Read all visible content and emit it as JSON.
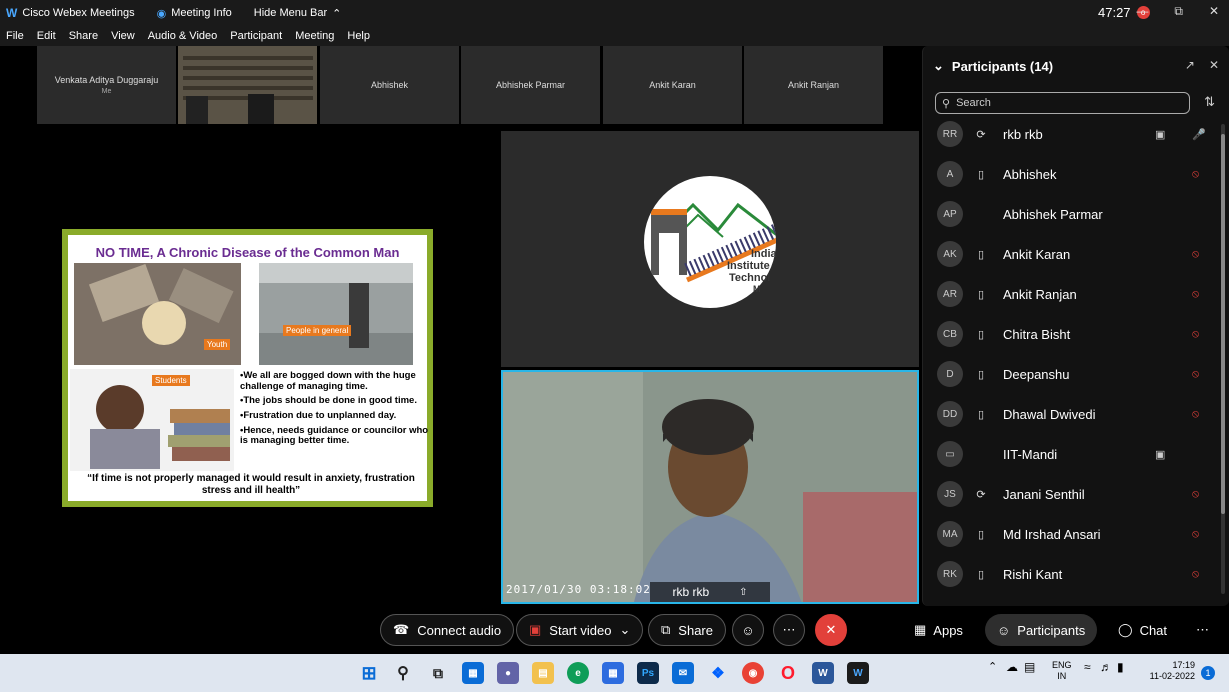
{
  "titlebar": {
    "app_name": "Cisco Webex Meetings",
    "meeting_info": "Meeting Info",
    "hide_menu": "Hide Menu Bar",
    "timer": "47:27",
    "rec_label": "o"
  },
  "menu": [
    "File",
    "Edit",
    "Share",
    "View",
    "Audio & Video",
    "Participant",
    "Meeting",
    "Help"
  ],
  "thumbnails": {
    "self_name": "Venkata Aditya Duggaraju",
    "self_sub": "Me",
    "others": [
      "Abhishek",
      "Abhishek Parmar",
      "Ankit Karan",
      "Ankit Ranjan"
    ]
  },
  "slide": {
    "title": "NO TIME, A Chronic Disease of the Common Man",
    "tag_youth": "Youth",
    "tag_people": "People in general",
    "tag_students": "Students",
    "bullets": [
      "We all are bogged down with the huge challenge of managing time.",
      "The jobs should be done in good time.",
      "Frustration due to unplanned day.",
      "Hence, needs guidance or councilor who is  managing better time."
    ],
    "quote": "“If time is not properly managed it would result in anxiety, frustration stress and ill health”"
  },
  "logo": {
    "text_line1": "India",
    "text_line2": "Institute",
    "text_line3": "Technol",
    "text_line4": "M"
  },
  "camera": {
    "timestamp": "2017/01/30 03:18:02",
    "name": "rkb rkb"
  },
  "participants": {
    "header": "Participants (14)",
    "search_placeholder": "Search",
    "list": [
      {
        "initials": "RR",
        "name": "rkb rkb",
        "device": "refresh",
        "video": true,
        "mic": "active"
      },
      {
        "initials": "A",
        "name": "Abhishek",
        "device": "phone",
        "video": false,
        "mic": "muted"
      },
      {
        "initials": "AP",
        "name": "Abhishek Parmar",
        "device": "",
        "video": false,
        "mic": ""
      },
      {
        "initials": "AK",
        "name": "Ankit Karan",
        "device": "phone",
        "video": false,
        "mic": "muted"
      },
      {
        "initials": "AR",
        "name": "Ankit Ranjan",
        "device": "phone",
        "video": false,
        "mic": "muted"
      },
      {
        "initials": "CB",
        "name": "Chitra Bisht",
        "device": "phone",
        "video": false,
        "mic": "muted"
      },
      {
        "initials": "D",
        "name": "Deepanshu",
        "device": "phone",
        "video": false,
        "mic": "muted"
      },
      {
        "initials": "DD",
        "name": "Dhawal Dwivedi",
        "device": "phone",
        "video": false,
        "mic": "muted"
      },
      {
        "initials": "",
        "name": "IIT-Mandi",
        "device": "",
        "video": true,
        "mic": ""
      },
      {
        "initials": "JS",
        "name": "Janani Senthil",
        "device": "refresh",
        "video": false,
        "mic": "muted"
      },
      {
        "initials": "MA",
        "name": "Md Irshad Ansari",
        "device": "phone",
        "video": false,
        "mic": "muted"
      },
      {
        "initials": "RK",
        "name": "Rishi Kant",
        "device": "phone",
        "video": false,
        "mic": "muted"
      }
    ]
  },
  "controls": {
    "connect_audio": "Connect audio",
    "start_video": "Start video",
    "share": "Share",
    "more": "⋯",
    "apps": "Apps",
    "participants": "Participants",
    "chat": "Chat"
  },
  "taskbar": {
    "lang_line1": "ENG",
    "lang_line2": "IN",
    "time": "17:19",
    "date": "11-02-2022",
    "notif_count": "1"
  }
}
